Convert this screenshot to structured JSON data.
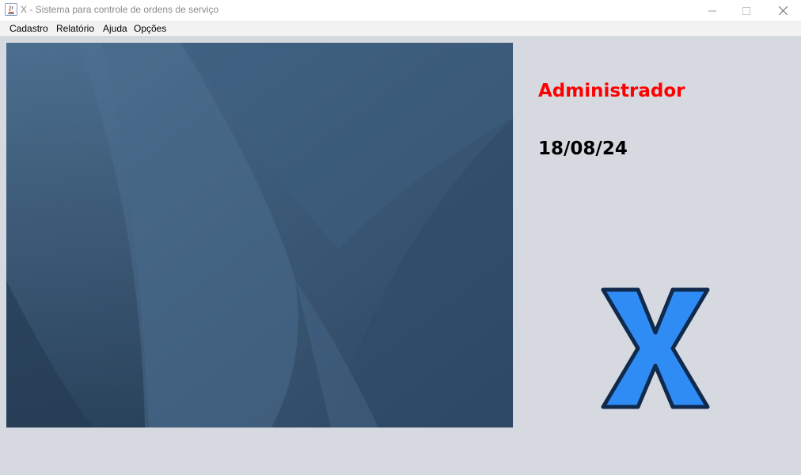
{
  "window": {
    "title": "X - Sistema para controle de ordens de serviço",
    "controls": {
      "minimize": "—",
      "maximize": "☐",
      "close": "✕"
    },
    "icons": {
      "app": "java-icon"
    }
  },
  "menubar": {
    "items": [
      {
        "label": "Cadastro"
      },
      {
        "label": "Relatório"
      },
      {
        "label": "Ajuda"
      },
      {
        "label": "Opções"
      }
    ]
  },
  "main": {
    "user": "Administrador",
    "date": "18/08/24",
    "logo_letter": "X"
  },
  "colors": {
    "user_text": "#ff0000",
    "date_text": "#000000",
    "logo_fill": "#2f8cf5",
    "logo_stroke": "#0f2a4d",
    "wallpaper_base": "#35506e",
    "background": "#d6d9e0"
  }
}
